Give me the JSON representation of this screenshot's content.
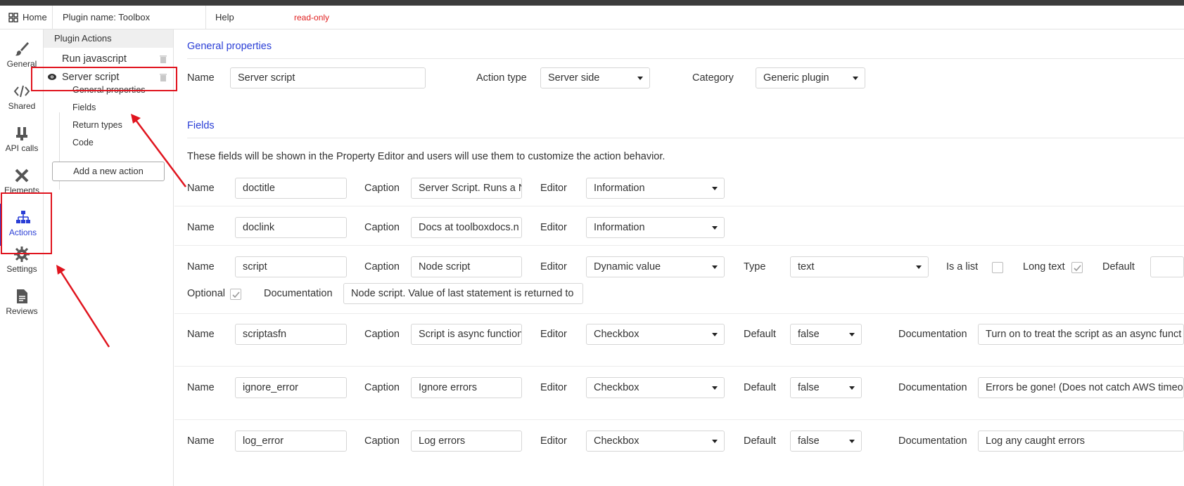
{
  "topbar": {
    "home_label": "Home",
    "plugin_name": "Plugin name: Toolbox",
    "help_label": "Help",
    "readonly_label": "read-only"
  },
  "leftnav": {
    "items": [
      {
        "label": "General",
        "icon": "brush-icon"
      },
      {
        "label": "Shared",
        "icon": "code-icon"
      },
      {
        "label": "API calls",
        "icon": "plug-icon"
      },
      {
        "label": "Elements",
        "icon": "tools-icon"
      },
      {
        "label": "Actions",
        "icon": "sitemap-icon"
      },
      {
        "label": "Settings",
        "icon": "gear-icon"
      },
      {
        "label": "Reviews",
        "icon": "document-icon"
      }
    ],
    "active": "Actions"
  },
  "actionpanel": {
    "header": "Plugin Actions",
    "actions": [
      {
        "label": "Run javascript"
      },
      {
        "label": "Server script"
      }
    ],
    "subitems": [
      "General properties",
      "Fields",
      "Return types",
      "Code"
    ],
    "add_label": "Add a new action"
  },
  "general": {
    "title": "General properties",
    "name_label": "Name",
    "name_value": "Server script",
    "action_type_label": "Action type",
    "action_type_value": "Server side",
    "category_label": "Category",
    "category_value": "Generic plugin"
  },
  "fields": {
    "title": "Fields",
    "description": "These fields will be shown in the Property Editor and users will use them to customize the action behavior.",
    "labels": {
      "name": "Name",
      "caption": "Caption",
      "editor": "Editor",
      "type": "Type",
      "is_list": "Is a list",
      "long_text": "Long text",
      "default": "Default",
      "optional": "Optional",
      "documentation": "Documentation"
    },
    "rows": [
      {
        "name": "doctitle",
        "caption": "Server Script. Runs a N",
        "editor": "Information"
      },
      {
        "name": "doclink",
        "caption": "Docs at toolboxdocs.n",
        "editor": "Information"
      },
      {
        "name": "script",
        "caption": "Node script",
        "editor": "Dynamic value",
        "type": "text",
        "is_list": false,
        "long_text": true,
        "optional": true,
        "documentation": "Node script. Value of last statement is returned to"
      },
      {
        "name": "scriptasfn",
        "caption": "Script is async function",
        "editor": "Checkbox",
        "default": "false",
        "documentation": "Turn on to treat the script as an async funct"
      },
      {
        "name": "ignore_error",
        "caption": "Ignore errors",
        "editor": "Checkbox",
        "default": "false",
        "documentation": "Errors be gone! (Does not catch AWS timeou"
      },
      {
        "name": "log_error",
        "caption": "Log errors",
        "editor": "Checkbox",
        "default": "false",
        "documentation": "Log any caught errors"
      }
    ]
  },
  "colors": {
    "accent": "#2a3ed6",
    "highlight": "#e0141e",
    "readonly": "#e02020"
  }
}
